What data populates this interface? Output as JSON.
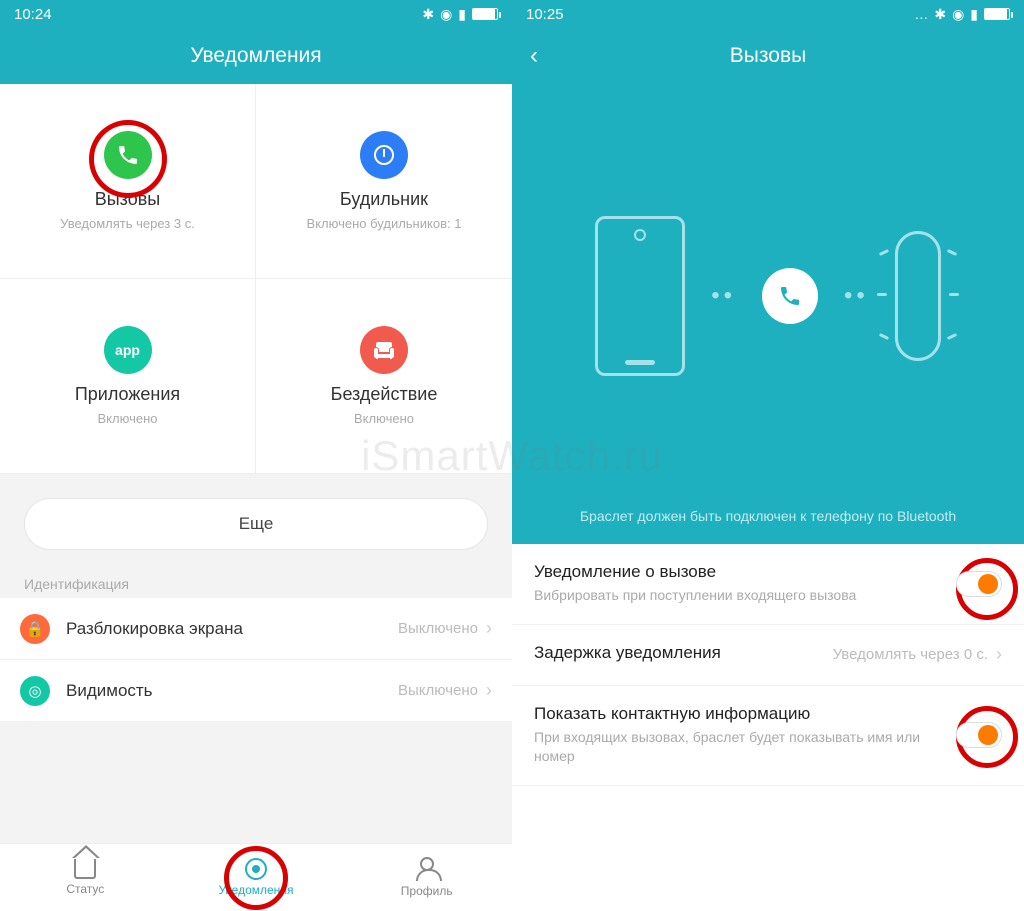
{
  "watermark": "iSmartWatch.ru",
  "left": {
    "time": "10:24",
    "header_title": "Уведомления",
    "tiles": {
      "calls": {
        "title": "Вызовы",
        "sub": "Уведомлять через 3 с."
      },
      "alarm": {
        "title": "Будильник",
        "sub": "Включено будильников: 1"
      },
      "apps": {
        "title": "Приложения",
        "sub": "Включено",
        "icon_label": "app"
      },
      "idle": {
        "title": "Бездействие",
        "sub": "Включено"
      }
    },
    "more_button": "Еще",
    "section_label": "Идентификация",
    "rows": {
      "unlock": {
        "title": "Разблокировка экрана",
        "value": "Выключено"
      },
      "visibility": {
        "title": "Видимость",
        "value": "Выключено"
      }
    },
    "nav": {
      "status": "Статус",
      "notifications": "Уведомления",
      "profile": "Профиль"
    }
  },
  "right": {
    "time": "10:25",
    "header_title": "Вызовы",
    "hero_note": "Браслет должен быть подключен к телефону по Bluetooth",
    "settings": {
      "call_notify": {
        "title": "Уведомление о вызове",
        "sub": "Вибрировать при поступлении входящего вызова",
        "on": true
      },
      "delay": {
        "title": "Задержка уведомления",
        "value": "Уведомлять через 0 с."
      },
      "contact_info": {
        "title": "Показать контактную информацию",
        "sub": "При входящих вызовах, браслет будет показывать имя или номер",
        "on": true
      }
    }
  }
}
